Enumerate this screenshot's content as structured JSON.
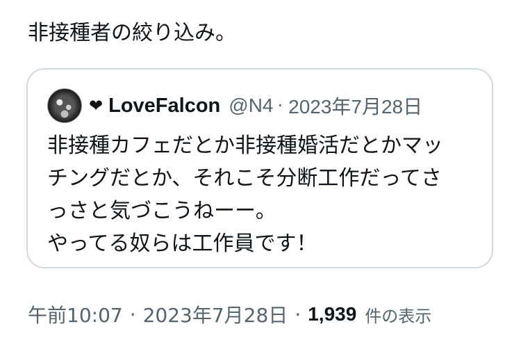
{
  "tweet": {
    "text": "非接種者の絞り込み。"
  },
  "quote": {
    "avatar_icon": "user-avatar",
    "heart_icon": "heart-icon",
    "heart_glyph": "❤",
    "display_name": "LoveFalcon",
    "handle": "@N4",
    "separator": "·",
    "date": "2023年7月28日",
    "lines": [
      "非接種カフェだとか非接種婚活だとかマッ",
      "チングだとか、それこそ分断工作だってさ",
      "っさと気づこうねーー。",
      "やってる奴らは工作員です！"
    ]
  },
  "meta": {
    "time": "午前10:07",
    "separator": "·",
    "date": "2023年7月28日",
    "view_count": "1,939",
    "view_label": "件の表示"
  },
  "colors": {
    "text_primary": "#0f1419",
    "text_secondary": "#536471",
    "border": "#cfd9de"
  }
}
